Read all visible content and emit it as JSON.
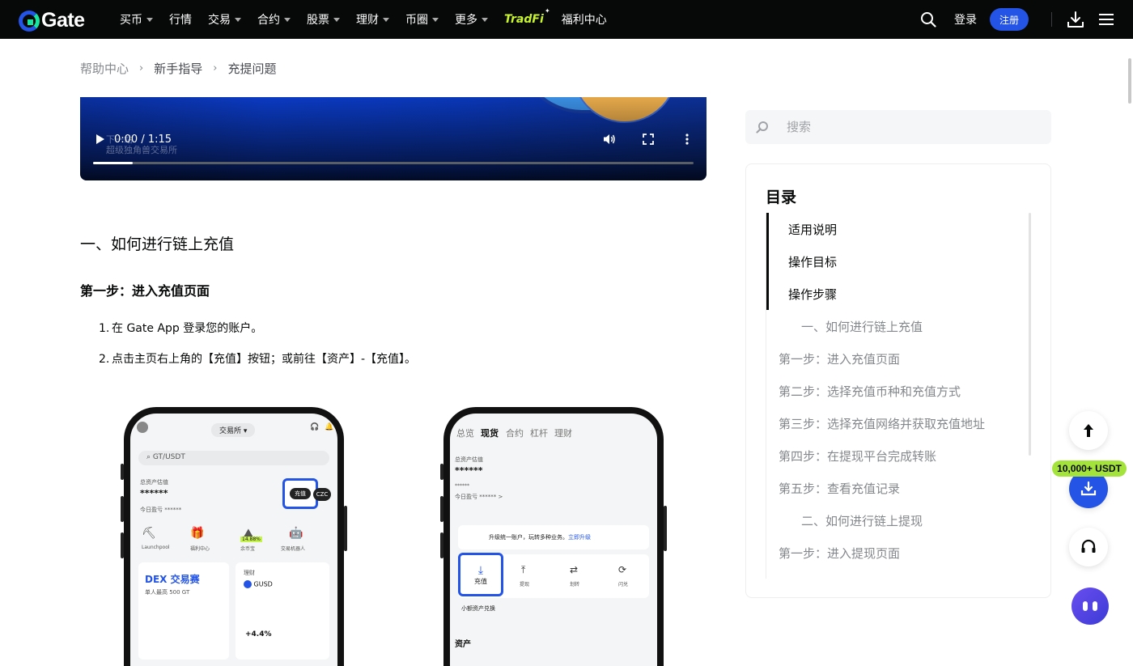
{
  "nav": {
    "logo_text": "Gate",
    "items": [
      {
        "label": "买币",
        "dropdown": true
      },
      {
        "label": "行情",
        "dropdown": false
      },
      {
        "label": "交易",
        "dropdown": true
      },
      {
        "label": "合约",
        "dropdown": true
      },
      {
        "label": "股票",
        "dropdown": true
      },
      {
        "label": "理财",
        "dropdown": true
      },
      {
        "label": "币圈",
        "dropdown": true
      },
      {
        "label": "更多",
        "dropdown": true
      }
    ],
    "tradfi": "TradFi",
    "welfare": "福利中心",
    "login": "登录",
    "register": "注册"
  },
  "breadcrumb": [
    "帮助中心",
    "新手指导",
    "充提问题"
  ],
  "video": {
    "time": "0:00 / 1:15",
    "ghost_line1": "下一站",
    "ghost_line2": "超级独角兽交易所",
    "progress": 0.066
  },
  "article": {
    "section_title": "一、如何进行链上充值",
    "step_title": "第一步：进入充值页面",
    "steps": [
      {
        "num": "1.",
        "text": "在 Gate App 登录您的账户。"
      },
      {
        "num": "2.",
        "text": "点击主页右上角的【充值】按钮；或前往【资产】-【充值】。"
      }
    ]
  },
  "phone1": {
    "tab": "交易所",
    "search": "GT/USDT",
    "assets_label": "总资产估值",
    "masked": "******",
    "today_pnl": "今日盈亏 ******",
    "deposit": "充值",
    "czc": "CZC",
    "shortcuts": [
      "Launchpool",
      "福利中心",
      "余币宝",
      "交易机器人"
    ],
    "apr_badge": "14.88%",
    "dex": "DEX 交易赛",
    "dex_sub": "单人最高 500 GT",
    "finance": "理财",
    "gusd": "GUSD",
    "gain": "+4.4%"
  },
  "phone2": {
    "tabs": [
      "总览",
      "现货",
      "合约",
      "杠杆",
      "理财"
    ],
    "assets_label": "总资产估值",
    "masked": "******",
    "small": "******",
    "today_pnl": "今日盈亏 ****** >",
    "upgrade": "升级统一账户，玩转多种业务。",
    "upgrade_link": "立即升级",
    "actions": [
      "充值",
      "提现",
      "划转",
      "闪兑"
    ],
    "small_convert": "小额资产兑换",
    "assets_title": "资产"
  },
  "search": {
    "placeholder": "搜索"
  },
  "toc": {
    "title": "目录",
    "items": [
      {
        "label": "适用说明",
        "level": 1
      },
      {
        "label": "操作目标",
        "level": 1
      },
      {
        "label": "操作步骤",
        "level": 1
      },
      {
        "label": "一、如何进行链上充值",
        "level": 2
      },
      {
        "label": "第一步：进入充值页面",
        "level": 3
      },
      {
        "label": "第二步：选择充值币种和充值方式",
        "level": 3
      },
      {
        "label": "第三步：选择充值网络并获取充值地址",
        "level": 3
      },
      {
        "label": "第四步：在提现平台完成转账",
        "level": 3
      },
      {
        "label": "第五步：查看充值记录",
        "level": 3
      },
      {
        "label": "二、如何进行链上提现",
        "level": 2
      },
      {
        "label": "第一步：进入提现页面",
        "level": 3
      }
    ]
  },
  "promo": "10,000+ USDT",
  "colors": {
    "brand": "#2354e6",
    "accent": "#17e5a1",
    "promo": "#a4e33c",
    "nav_bg": "#070808"
  }
}
